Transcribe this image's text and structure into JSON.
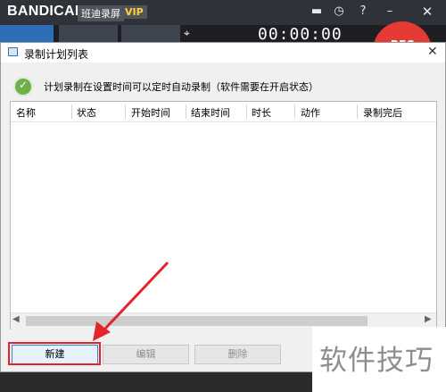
{
  "app": {
    "logo_text": "BANDICAM",
    "name_badge": "班迪录屏",
    "vip_badge": "VIP",
    "timer": "00:00:00",
    "rec_label": "REC"
  },
  "dialog": {
    "title": "录制计划列表",
    "info_text": "计划录制在设置时间可以定时自动录制（软件需要在开启状态）",
    "columns": [
      "名称",
      "状态",
      "开始时间",
      "结束时间",
      "时长",
      "动作",
      "录制完后"
    ],
    "rows": [],
    "buttons": {
      "new": "新建",
      "edit": "编辑",
      "delete": "删除"
    }
  },
  "annotation": {
    "highlight_color": "#e2242c"
  },
  "watermark": "软件技巧",
  "icons": [
    "folder-icon",
    "clock-icon",
    "help-icon",
    "minimize-icon",
    "close-icon",
    "mouse-icon",
    "info-check-icon",
    "scroll-left-icon",
    "scroll-right-icon"
  ]
}
